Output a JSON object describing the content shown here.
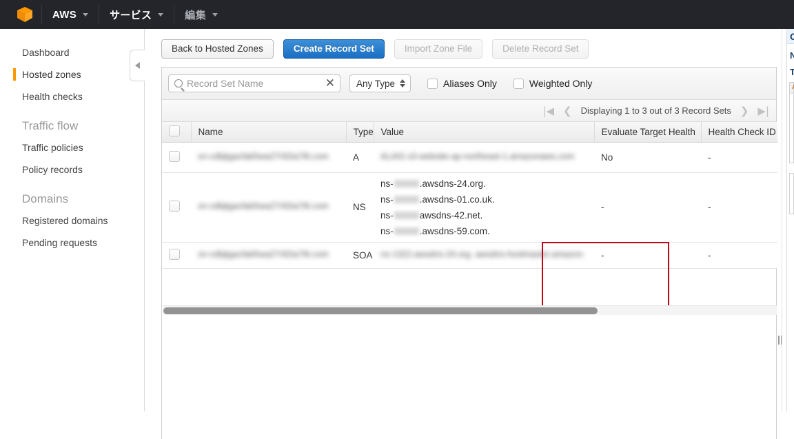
{
  "topnav": {
    "logo_icon": "aws-cube-icon",
    "items": [
      {
        "label": "AWS",
        "caret_icon": "chevron-down-icon"
      },
      {
        "label": "サービス",
        "caret_icon": "chevron-down-icon"
      },
      {
        "label": "編集",
        "caret_icon": "chevron-down-icon"
      }
    ]
  },
  "sidebar": {
    "items": [
      {
        "label": "Dashboard",
        "active": false
      },
      {
        "label": "Hosted zones",
        "active": true
      },
      {
        "label": "Health checks",
        "active": false
      }
    ],
    "sections": [
      {
        "heading": "Traffic flow",
        "items": [
          {
            "label": "Traffic policies"
          },
          {
            "label": "Policy records"
          }
        ]
      },
      {
        "heading": "Domains",
        "items": [
          {
            "label": "Registered domains"
          },
          {
            "label": "Pending requests"
          }
        ]
      }
    ],
    "collapse_icon": "chevron-left-icon"
  },
  "toolbar": {
    "back_label": "Back to Hosted Zones",
    "create_label": "Create Record Set",
    "import_label": "Import Zone File",
    "delete_label": "Delete Record Set"
  },
  "filter": {
    "search_icon": "search-icon",
    "search_value": "",
    "search_placeholder": "Record Set Name",
    "clear_icon": "✕",
    "type_select_value": "Any Type",
    "aliases_only_label": "Aliases Only",
    "weighted_only_label": "Weighted Only"
  },
  "pagination": {
    "first_icon": "|◀",
    "prev_icon": "❮",
    "status": "Displaying 1 to 3 out of 3 Record Sets",
    "next_icon": "❯",
    "last_icon": "▶|"
  },
  "table": {
    "columns": [
      "Name",
      "Type",
      "Value",
      "Evaluate Target Health",
      "Health Check ID"
    ],
    "rows": [
      {
        "name": "xn-cdbjtgacfab5wa27r92ia78i.com",
        "name_redacted": true,
        "type": "A",
        "value": "ALIAS s3-website-ap-northeast-1.amazonaws.com",
        "value_redacted": true,
        "evaluate_target_health": "No",
        "health_check_id": "-"
      },
      {
        "name": "xn-cdbjtgacfab5wa27r92ia78i.com",
        "name_redacted": true,
        "type": "NS",
        "ns_values": [
          {
            "prefix": "ns-",
            "suffix": ".awsdns-24.org."
          },
          {
            "prefix": "ns-",
            "suffix": ".awsdns-01.co.uk."
          },
          {
            "prefix": "ns-",
            "suffix": "awsdns-42.net."
          },
          {
            "prefix": "ns-",
            "suffix": ".awsdns-59.com."
          }
        ],
        "highlighted": true,
        "highlight_color": "#c00418",
        "evaluate_target_health": "-",
        "health_check_id": "-"
      },
      {
        "name": "xn-cdbjtgacfab5wa27r92ia78i.com",
        "name_redacted": true,
        "type": "SOA",
        "value": "ns-1322.awsdns-24.org. awsdns-hostmaster.amazon.",
        "value_redacted": true,
        "evaluate_target_health": "-",
        "health_check_id": "-"
      }
    ]
  },
  "right_panel": {
    "header": "Create Record Set",
    "name_label": "Name:",
    "type_label": "Type:",
    "alias_label": "Alias:",
    "drag_handle_icon": "column-resize-handle-icon"
  },
  "colors": {
    "navbar": "#23252a",
    "accent_orange": "#ff9900",
    "primary_blue": "#1a6fc4",
    "highlight_red": "#c00418"
  }
}
